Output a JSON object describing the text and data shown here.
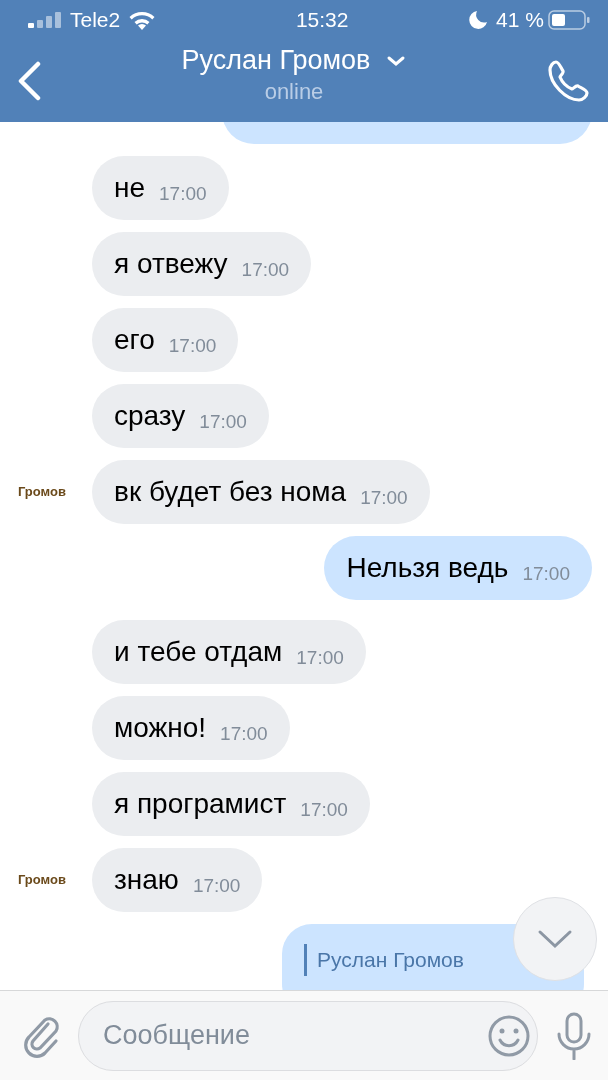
{
  "status_bar": {
    "carrier": "Tele2",
    "time": "15:32",
    "battery": "41 %"
  },
  "header": {
    "title": "Руслан Громов",
    "subtitle": "online"
  },
  "messages": [
    {
      "kind": "partial"
    },
    {
      "kind": "incoming",
      "text": "не",
      "time": "17:00"
    },
    {
      "kind": "incoming",
      "text": "я отвежу",
      "time": "17:00"
    },
    {
      "kind": "incoming",
      "text": "его",
      "time": "17:00"
    },
    {
      "kind": "incoming",
      "text": "сразу",
      "time": "17:00"
    },
    {
      "kind": "incoming",
      "text": "вк будет без нома",
      "time": "17:00",
      "sender": "Громов"
    },
    {
      "kind": "outgoing",
      "text": "Нельзя ведь",
      "time": "17:00"
    },
    {
      "kind": "incoming",
      "text": "и тебе отдам",
      "time": "17:00"
    },
    {
      "kind": "incoming",
      "text": "можно!",
      "time": "17:00"
    },
    {
      "kind": "incoming",
      "text": "я програмист",
      "time": "17:00"
    },
    {
      "kind": "incoming",
      "text": "знаю",
      "time": "17:00",
      "sender": "Громов"
    },
    {
      "kind": "reply",
      "quote": "Руслан Громов"
    }
  ],
  "composer": {
    "placeholder": "Сообщение"
  }
}
